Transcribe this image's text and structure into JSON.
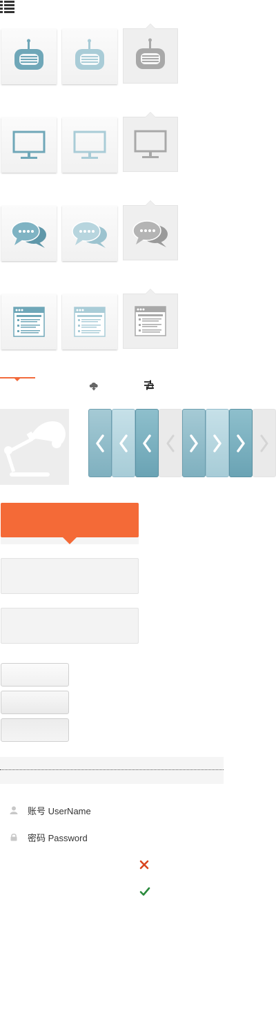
{
  "sprite_icons": [
    "radio-icon",
    "monitor-icon",
    "chat-bubbles-icon",
    "browser-window-icon"
  ],
  "sprite_states": [
    "normal",
    "light",
    "active"
  ],
  "colors": {
    "teal": "#6fa7b8",
    "teal_light": "#a9ccd7",
    "gray": "#a8a8a8",
    "orange": "#f46a37",
    "error_red": "#d9451f",
    "success_green": "#2a8a3c"
  },
  "form": {
    "username_label": "账号 UserName",
    "password_label": "密码 Password"
  },
  "status": {
    "error_symbol": "✕",
    "success_symbol": "✓"
  }
}
